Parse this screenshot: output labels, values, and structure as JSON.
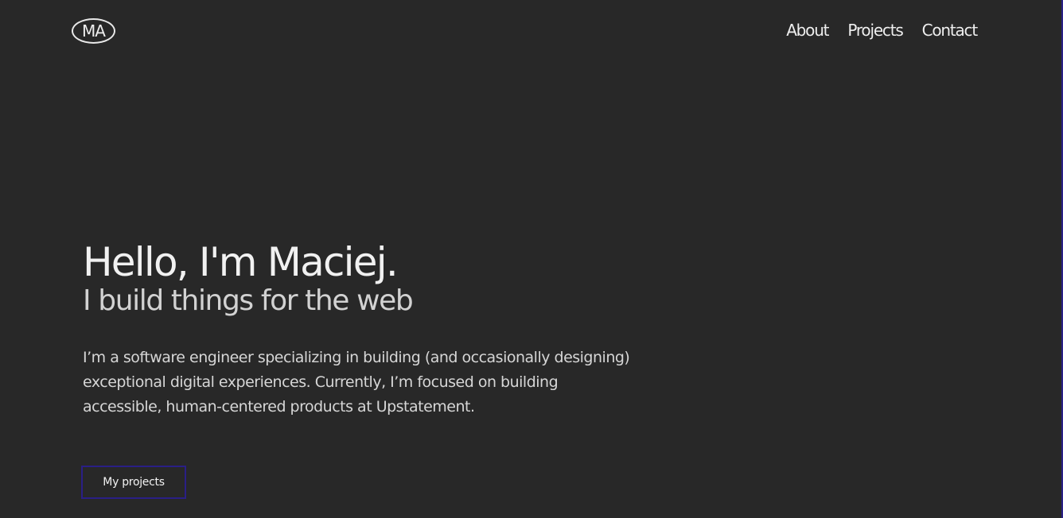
{
  "header": {
    "logo_text": "MA",
    "nav": [
      {
        "label": "About"
      },
      {
        "label": "Projects"
      },
      {
        "label": "Contact"
      }
    ]
  },
  "hero": {
    "greeting": "Hello, I'm Maciej.",
    "subtitle": "I build things for the web",
    "bio": "I’m a software engineer specializing in building (and occasionally designing) exceptional digital experiences. Currently, I’m focused on building accessible, human-centered products at Upstatement.",
    "cta_label": "My projects"
  },
  "colors": {
    "background": "#282828",
    "accent": "#2a1f86",
    "text": "#e8e8e8"
  }
}
